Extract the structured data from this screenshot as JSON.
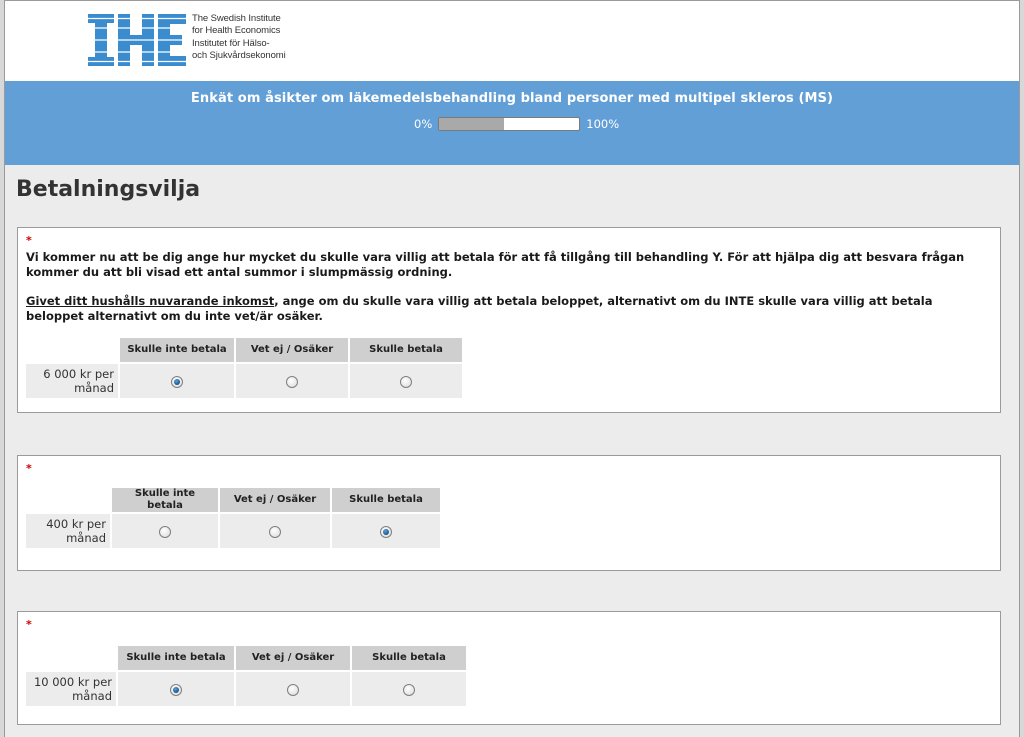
{
  "header": {
    "logo_mark": "IHE",
    "logo_lines": [
      "The Swedish Institute",
      "for Health Economics",
      "Institutet för Hälso-",
      "och Sjukvårdsekonomi"
    ],
    "logo_color": "#3a8ccf"
  },
  "banner": {
    "title": "Enkät om åsikter om läkemedelsbehandling bland personer med multipel skleros (MS)",
    "progress_start": "0%",
    "progress_end": "100%",
    "progress_fraction": 0.46,
    "color": "#629fd6"
  },
  "page": {
    "title": "Betalningsvilja"
  },
  "questions": [
    {
      "required_mark": "*",
      "text_1": "Vi kommer nu att be dig ange hur mycket du skulle vara villig att betala för att få tillgång till behandling Y. För att hjälpa dig att besvara frågan kommer du att bli visad ett antal summor i slumpmässig ordning.",
      "text_2_underlined": "Givet ditt hushålls nuvarande inkomst",
      "text_2_rest": ", ange om du skulle vara villig att betala beloppet, alternativt om du INTE skulle vara villig att betala beloppet alternativt om du inte vet/är osäker.",
      "columns": [
        "Skulle inte betala",
        "Vet ej / Osäker",
        "Skulle betala"
      ],
      "row_label": "6 000 kr per månad",
      "selected": 0
    },
    {
      "required_mark": "*",
      "columns": [
        "Skulle inte betala",
        "Vet ej / Osäker",
        "Skulle betala"
      ],
      "row_label": "400 kr per månad",
      "selected": 2
    },
    {
      "required_mark": "*",
      "columns": [
        "Skulle inte betala",
        "Vet ej / Osäker",
        "Skulle betala"
      ],
      "row_label": "10 000 kr per månad",
      "selected": 0
    }
  ]
}
